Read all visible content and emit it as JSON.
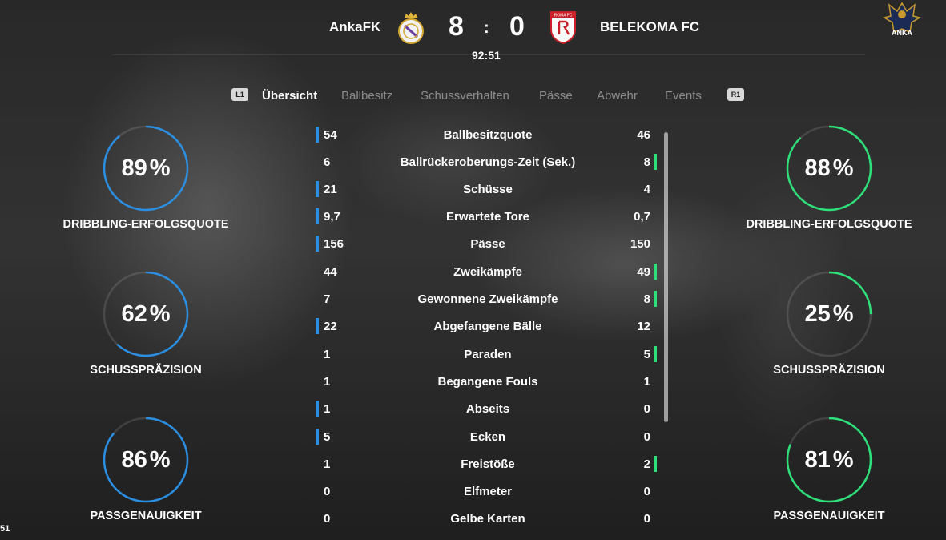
{
  "header": {
    "home_team": "AnkaFK",
    "away_team": "BELEKOMA FC",
    "home_score": "8",
    "separator": ":",
    "away_score": "0",
    "clock": "92:51",
    "away_crest_text": "ROMA FC",
    "corner_logo_text": "ANKA"
  },
  "tabs": {
    "left_button": "L1",
    "right_button": "R1",
    "items": [
      "Übersicht",
      "Ballbesitz",
      "Schussverhalten",
      "Pässe",
      "Abwehr",
      "Events"
    ],
    "active": "Übersicht"
  },
  "left_rings": [
    {
      "value": "89",
      "unit": "%",
      "label": "DRIBBLING-ERFOLGSQUOTE",
      "fraction": 0.89
    },
    {
      "value": "62",
      "unit": "%",
      "label": "SCHUSSPRÄZISION",
      "fraction": 0.62
    },
    {
      "value": "86",
      "unit": "%",
      "label": "PASSGENAUIGKEIT",
      "fraction": 0.86
    }
  ],
  "right_rings": [
    {
      "value": "88",
      "unit": "%",
      "label": "DRIBBLING-ERFOLGSQUOTE",
      "fraction": 0.88
    },
    {
      "value": "25",
      "unit": "%",
      "label": "SCHUSSPRÄZISION",
      "fraction": 0.25
    },
    {
      "value": "81",
      "unit": "%",
      "label": "PASSGENAUIGKEIT",
      "fraction": 0.81
    }
  ],
  "colors": {
    "home": "#2a8fe3",
    "away": "#2ee07a",
    "track": "rgba(255,255,255,0.12)"
  },
  "stats": [
    {
      "name": "Ballbesitzquote",
      "home": "54",
      "away": "46",
      "lead": "home"
    },
    {
      "name": "Ballrückeroberungs-Zeit (Sek.)",
      "home": "6",
      "away": "8",
      "lead": "away"
    },
    {
      "name": "Schüsse",
      "home": "21",
      "away": "4",
      "lead": "home"
    },
    {
      "name": "Erwartete Tore",
      "home": "9,7",
      "away": "0,7",
      "lead": "home"
    },
    {
      "name": "Pässe",
      "home": "156",
      "away": "150",
      "lead": "home"
    },
    {
      "name": "Zweikämpfe",
      "home": "44",
      "away": "49",
      "lead": "away"
    },
    {
      "name": "Gewonnene Zweikämpfe",
      "home": "7",
      "away": "8",
      "lead": "away"
    },
    {
      "name": "Abgefangene Bälle",
      "home": "22",
      "away": "12",
      "lead": "home"
    },
    {
      "name": "Paraden",
      "home": "1",
      "away": "5",
      "lead": "away"
    },
    {
      "name": "Begangene Fouls",
      "home": "1",
      "away": "1",
      "lead": "none"
    },
    {
      "name": "Abseits",
      "home": "1",
      "away": "0",
      "lead": "home"
    },
    {
      "name": "Ecken",
      "home": "5",
      "away": "0",
      "lead": "home"
    },
    {
      "name": "Freistöße",
      "home": "1",
      "away": "2",
      "lead": "away"
    },
    {
      "name": "Elfmeter",
      "home": "0",
      "away": "0",
      "lead": "none"
    },
    {
      "name": "Gelbe Karten",
      "home": "0",
      "away": "0",
      "lead": "none"
    }
  ],
  "corner_text": "51"
}
